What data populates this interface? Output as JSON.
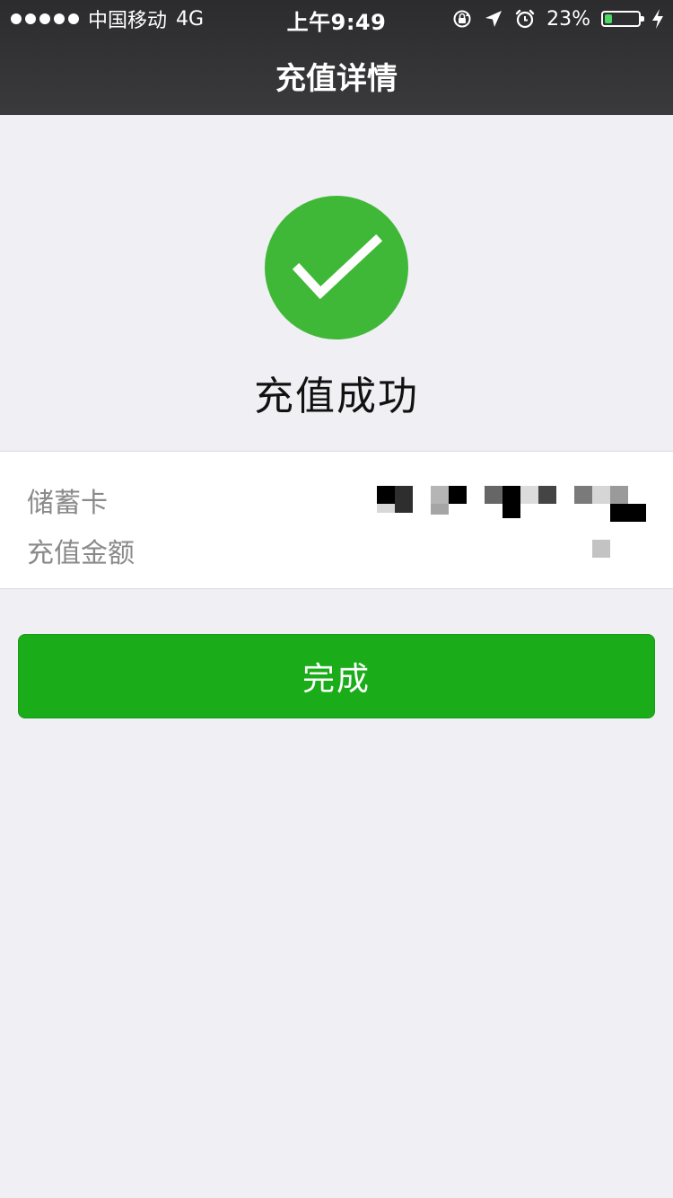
{
  "status_bar": {
    "carrier": "中国移动",
    "network": "4G",
    "time": "上午9:49",
    "battery_percent": "23%",
    "battery_level": 0.23,
    "icons": [
      "rotation-lock-icon",
      "location-arrow-icon",
      "alarm-icon",
      "battery-icon",
      "charging-bolt-icon"
    ]
  },
  "nav": {
    "title": "充值详情"
  },
  "success": {
    "icon": "checkmark-icon",
    "text": "充值成功",
    "color": "#3fb837"
  },
  "details": {
    "rows": [
      {
        "label": "储蓄卡",
        "value": ""
      },
      {
        "label": "充值金额",
        "value": ""
      }
    ]
  },
  "actions": {
    "done_label": "完成",
    "color": "#1aad19"
  }
}
